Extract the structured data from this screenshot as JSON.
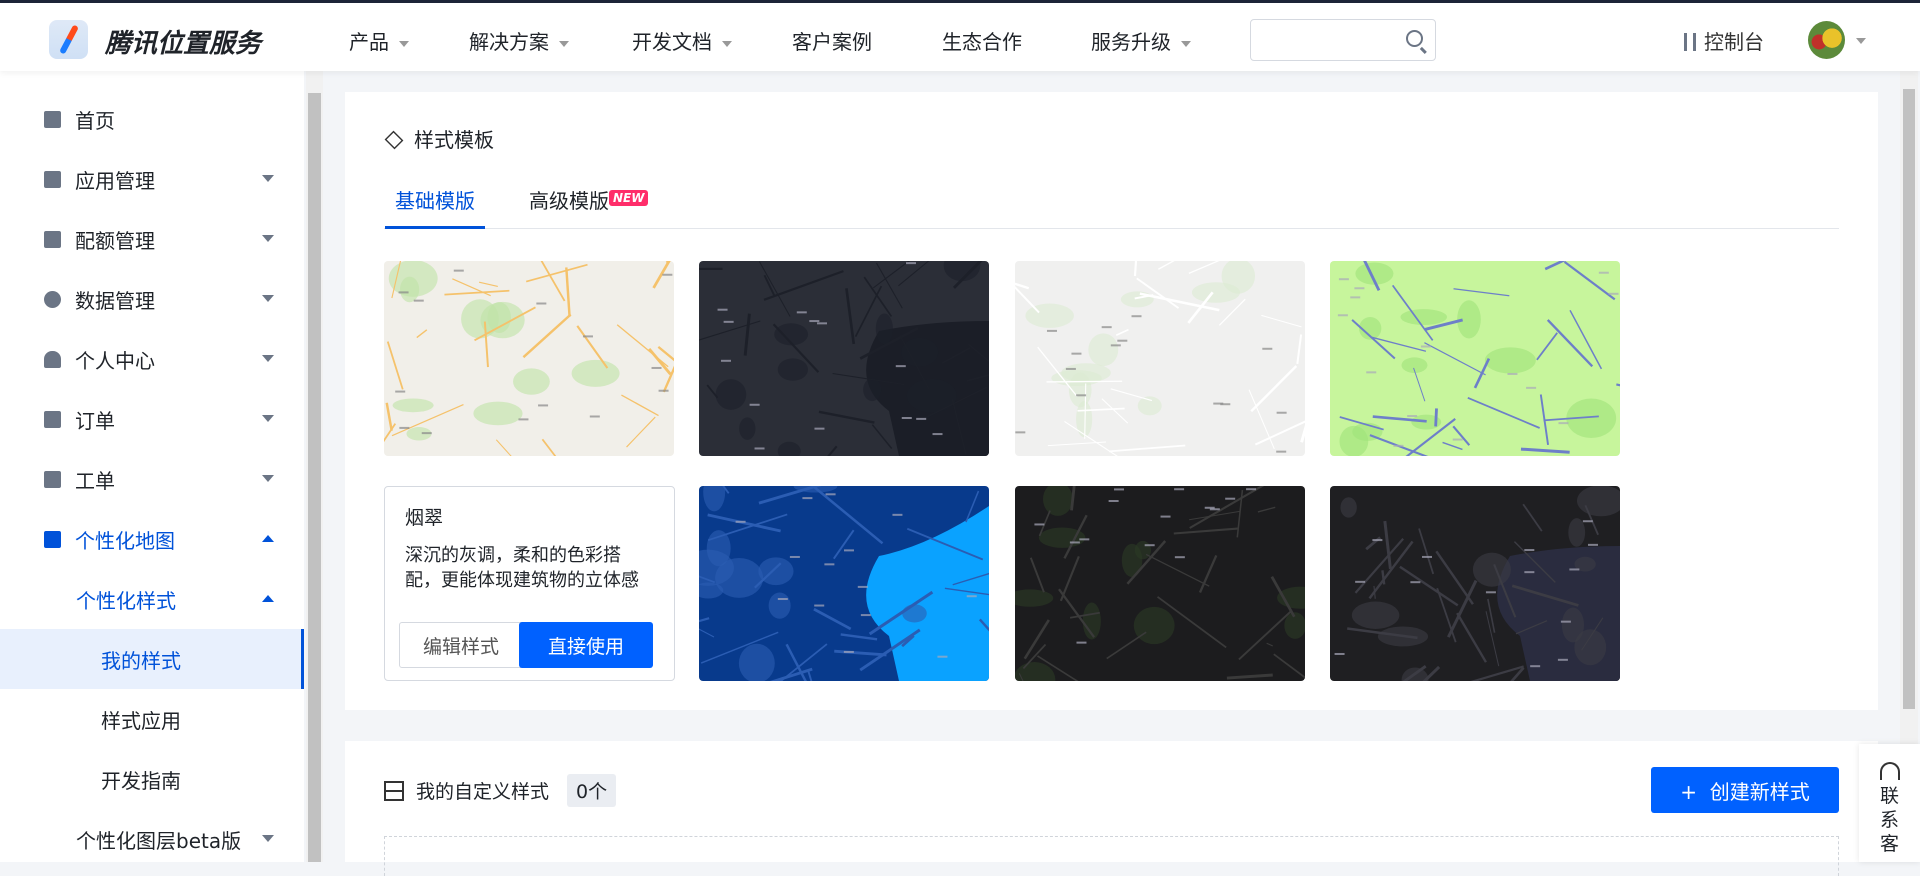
{
  "header": {
    "brand": "腾讯位置服务",
    "nav": [
      {
        "label": "产品",
        "dropdown": true
      },
      {
        "label": "解决方案",
        "dropdown": true
      },
      {
        "label": "开发文档",
        "dropdown": true
      },
      {
        "label": "客户案例",
        "dropdown": false
      },
      {
        "label": "生态合作",
        "dropdown": false
      },
      {
        "label": "服务升级",
        "dropdown": true
      }
    ],
    "search_placeholder": "",
    "console": "控制台"
  },
  "sidebar": {
    "items": [
      {
        "label": "首页"
      },
      {
        "label": "应用管理"
      },
      {
        "label": "配额管理"
      },
      {
        "label": "数据管理"
      },
      {
        "label": "个人中心"
      },
      {
        "label": "订单"
      },
      {
        "label": "工单"
      },
      {
        "label": "个性化地图"
      },
      {
        "label": "个性化样式"
      },
      {
        "label": "我的样式"
      },
      {
        "label": "样式应用"
      },
      {
        "label": "开发指南"
      },
      {
        "label": "个性化图层beta版"
      }
    ]
  },
  "templates": {
    "title": "样式模板",
    "tabs": [
      {
        "label": "基础模版"
      },
      {
        "label": "高级模版"
      }
    ],
    "new_badge": "NEW",
    "maps": [
      {
        "name": "standard",
        "bg": "#f1efe9",
        "line": "#f5c26b",
        "accent": "#bfe3a6"
      },
      {
        "name": "dark",
        "bg": "#2b2e37",
        "line": "#1d2029",
        "accent": "#4caf50"
      },
      {
        "name": "light-gray",
        "bg": "#f0f0ef",
        "line": "#ffffff",
        "accent": "#dcebd2"
      },
      {
        "name": "lime",
        "bg": "#c7f59c",
        "line": "#6d7fc9",
        "accent": "#9fe27a"
      },
      {
        "name": "blue",
        "bg": "#083a8c",
        "line": "#2b5db3",
        "accent": "#0aa2ff"
      },
      {
        "name": "night",
        "bg": "#1c1c1e",
        "line": "#3a3a3a",
        "accent": "#2b3a24"
      },
      {
        "name": "midnight",
        "bg": "#1f1f22",
        "line": "#3c3c44",
        "accent": "#2a2c3f"
      }
    ],
    "hover_card": {
      "title": "烟翠",
      "desc": "深沉的灰调，柔和的色彩搭配，更能体现建筑物的立体感",
      "edit": "编辑样式",
      "use": "直接使用"
    }
  },
  "custom": {
    "title": "我的自定义样式",
    "count": "0个",
    "create": "创建新样式"
  },
  "contact": "联系客"
}
